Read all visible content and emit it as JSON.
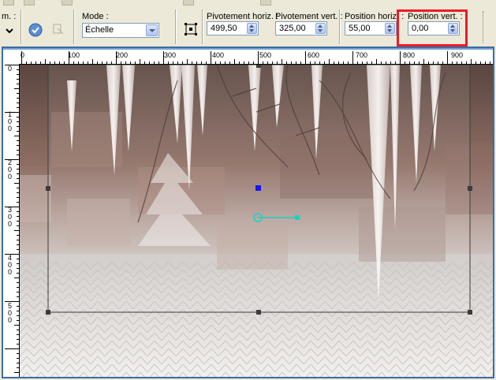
{
  "toolbar": {
    "partial_label": "m. :",
    "mode": {
      "label": "Mode :",
      "value": "Échelle"
    },
    "pivot_h": {
      "label": "Pivotement horiz. :",
      "value": "499,50"
    },
    "pivot_v": {
      "label": "Pivotement vert. :",
      "value": "325,00"
    },
    "pos_h": {
      "label": "Position horiz. :",
      "value": "55,00"
    },
    "pos_v": {
      "label": "Position vert. :",
      "value": "0,00"
    }
  },
  "ruler": {
    "horizontal_labels": [
      "0",
      "100",
      "200",
      "300",
      "400",
      "500",
      "600",
      "700",
      "800",
      "900"
    ],
    "vertical_labels": [
      "0",
      "100",
      "200",
      "300",
      "400",
      "500"
    ]
  },
  "colors": {
    "highlight": "#ec1c24",
    "frame_border": "#3a6ea5",
    "handle_blue": "#1515ff",
    "handle_cyan": "#1ad0c8"
  },
  "icons": {
    "dropdown": "chevron-down-icon",
    "apply": "apply-icon",
    "transform": "transform-icon",
    "center": "center-icon"
  }
}
